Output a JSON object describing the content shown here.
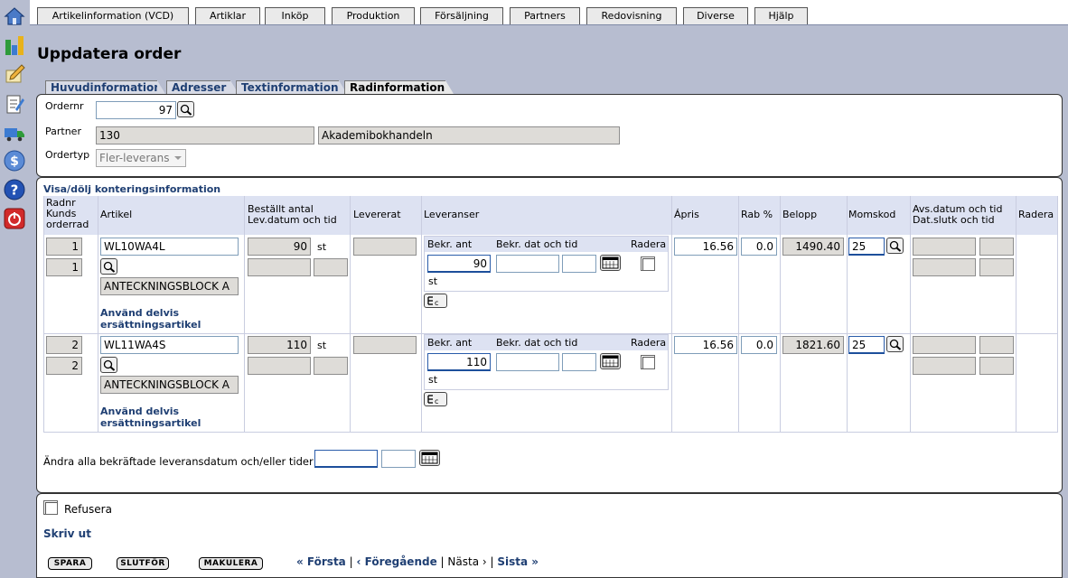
{
  "nav": {
    "tabs": [
      "Artikelinformation (VCD)",
      "Artiklar",
      "Inköp",
      "Produktion",
      "Försäljning",
      "Partners",
      "Redovisning",
      "Diverse",
      "Hjälp"
    ]
  },
  "sidebar": {
    "icons": [
      "home-icon",
      "chart-icon",
      "edit-icon",
      "notes-icon",
      "truck-icon",
      "dollar-icon",
      "help-icon",
      "logout-icon"
    ]
  },
  "page": {
    "title": "Uppdatera order",
    "subtabs": [
      "Huvudinformation",
      "Adresser",
      "Textinformation",
      "Radinformation"
    ]
  },
  "header": {
    "ordernr_label": "Ordernr",
    "ordernr_value": "97",
    "partner_label": "Partner",
    "partner_code": "130",
    "partner_name": "Akademibokhandeln",
    "ordertyp_label": "Ordertyp",
    "ordertyp_value": "Fler-leverans"
  },
  "rows_section": {
    "toggle_link": "Visa/dölj konteringsinformation",
    "columns": {
      "radnr": "Radnr",
      "kunds": "Kunds",
      "orderrad": "orderrad",
      "artikel": "Artikel",
      "bestallt": "Beställt antal",
      "levdatum": "Lev.datum och tid",
      "levererat": "Levererat",
      "leveranser": "Leveranser",
      "apris": "Ápris",
      "rab": "Rab %",
      "belopp": "Belopp",
      "momskod": "Momskod",
      "avsdatum": "Avs.datum och tid",
      "datslutk": "Dat.slutk och tid",
      "radera": "Radera"
    },
    "lev_columns": {
      "bekr_ant": "Bekr. ant",
      "bekr_dat": "Bekr. dat och tid",
      "radera": "Radera"
    },
    "rows": [
      {
        "radnr": "1",
        "kunds_rad": "1",
        "artikel": "WL10WA4L",
        "artikel_name": "ANTECKNINGSBLOCK A",
        "bestallt": "90",
        "unit": "st",
        "bekr_ant": "90",
        "bekr_unit": "st",
        "apris": "16.56",
        "rab": "0.0",
        "belopp": "1490.40",
        "momskod": "25",
        "replace_link_1": "Använd delvis",
        "replace_link_2": "ersättningsartikel"
      },
      {
        "radnr": "2",
        "kunds_rad": "2",
        "artikel": "WL11WA4S",
        "artikel_name": "ANTECKNINGSBLOCK A",
        "bestallt": "110",
        "unit": "st",
        "bekr_ant": "110",
        "bekr_unit": "st",
        "apris": "16.56",
        "rab": "0.0",
        "belopp": "1821.60",
        "momskod": "25",
        "replace_link_1": "Använd delvis",
        "replace_link_2": "ersättningsartikel"
      }
    ],
    "change_all_label": "Ändra alla bekräftade leveransdatum och/eller tider"
  },
  "footer": {
    "refusera_label": "Refusera",
    "print_link": "Skriv ut",
    "buttons": [
      "SPARA",
      "SLUTFÖR",
      "MAKULERA"
    ],
    "pager": {
      "first": "« Första",
      "sep1": "|",
      "prev": "‹ Föregående",
      "sep2": "|",
      "next": "Nästa ›",
      "sep3": "|",
      "last": "Sista »"
    }
  }
}
